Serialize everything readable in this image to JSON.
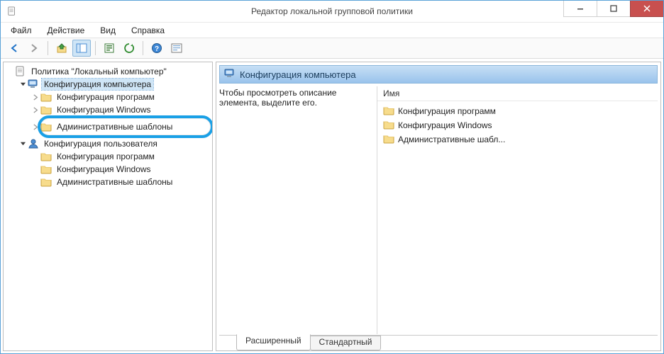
{
  "window": {
    "title": "Редактор локальной групповой политики"
  },
  "menu": {
    "file": "Файл",
    "action": "Действие",
    "view": "Вид",
    "help": "Справка"
  },
  "tree": {
    "root": "Политика \"Локальный компьютер\"",
    "computer": {
      "label": "Конфигурация компьютера",
      "children": {
        "software": "Конфигурация программ",
        "windows": "Конфигурация Windows",
        "admin_templates": "Административные шаблоны"
      }
    },
    "user": {
      "label": "Конфигурация пользователя",
      "children": {
        "software": "Конфигурация программ",
        "windows": "Конфигурация Windows",
        "admin_templates": "Административные шаблоны"
      }
    }
  },
  "detail": {
    "header": "Конфигурация компьютера",
    "hint": "Чтобы просмотреть описание элемента, выделите его.",
    "column_name": "Имя",
    "items": {
      "software": "Конфигурация программ",
      "windows": "Конфигурация Windows",
      "admin_templates": "Административные шабл..."
    },
    "tabs": {
      "extended": "Расширенный",
      "standard": "Стандартный"
    }
  }
}
